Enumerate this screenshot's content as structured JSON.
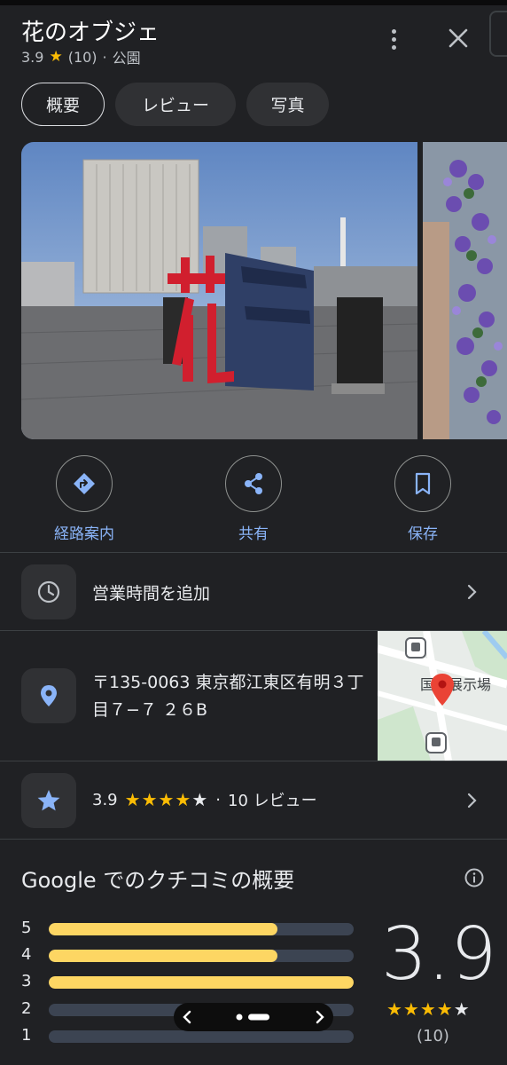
{
  "header": {
    "title": "花のオブジェ",
    "rating": "3.9",
    "review_count": "(10)",
    "separator": "·",
    "category": "公園"
  },
  "tabs": [
    {
      "label": "概要",
      "active": true
    },
    {
      "label": "レビュー",
      "active": false
    },
    {
      "label": "写真",
      "active": false
    }
  ],
  "actions": [
    {
      "label": "経路案内",
      "icon": "directions-icon"
    },
    {
      "label": "共有",
      "icon": "share-icon"
    },
    {
      "label": "保存",
      "icon": "bookmark-icon"
    }
  ],
  "hours": {
    "label": "営業時間を追加",
    "icon": "clock-icon"
  },
  "address": {
    "text": "〒135-0063 東京都江東区有明３丁目７−７ ２６B",
    "icon": "location-pin-icon"
  },
  "map": {
    "label": "国際展示場"
  },
  "rating_row": {
    "value": "3.9",
    "stars": 3.9,
    "separator": "·",
    "reviews": "10 レビュー",
    "icon": "star-icon"
  },
  "summary": {
    "title": "Google でのクチコミの概要",
    "big_rating": "3.9",
    "stars": 3.9,
    "count": "(10)",
    "distribution": [
      {
        "label": "5",
        "fraction": 0.75
      },
      {
        "label": "4",
        "fraction": 0.75
      },
      {
        "label": "3",
        "fraction": 1.0
      },
      {
        "label": "2",
        "fraction": 0.0
      },
      {
        "label": "1",
        "fraction": 0.0
      }
    ]
  },
  "colors": {
    "background": "#202124",
    "accent_blue": "#8ab4f8",
    "star_yellow": "#fbbc04",
    "bar_fill": "#fdd663",
    "bar_track": "#3c4452"
  }
}
